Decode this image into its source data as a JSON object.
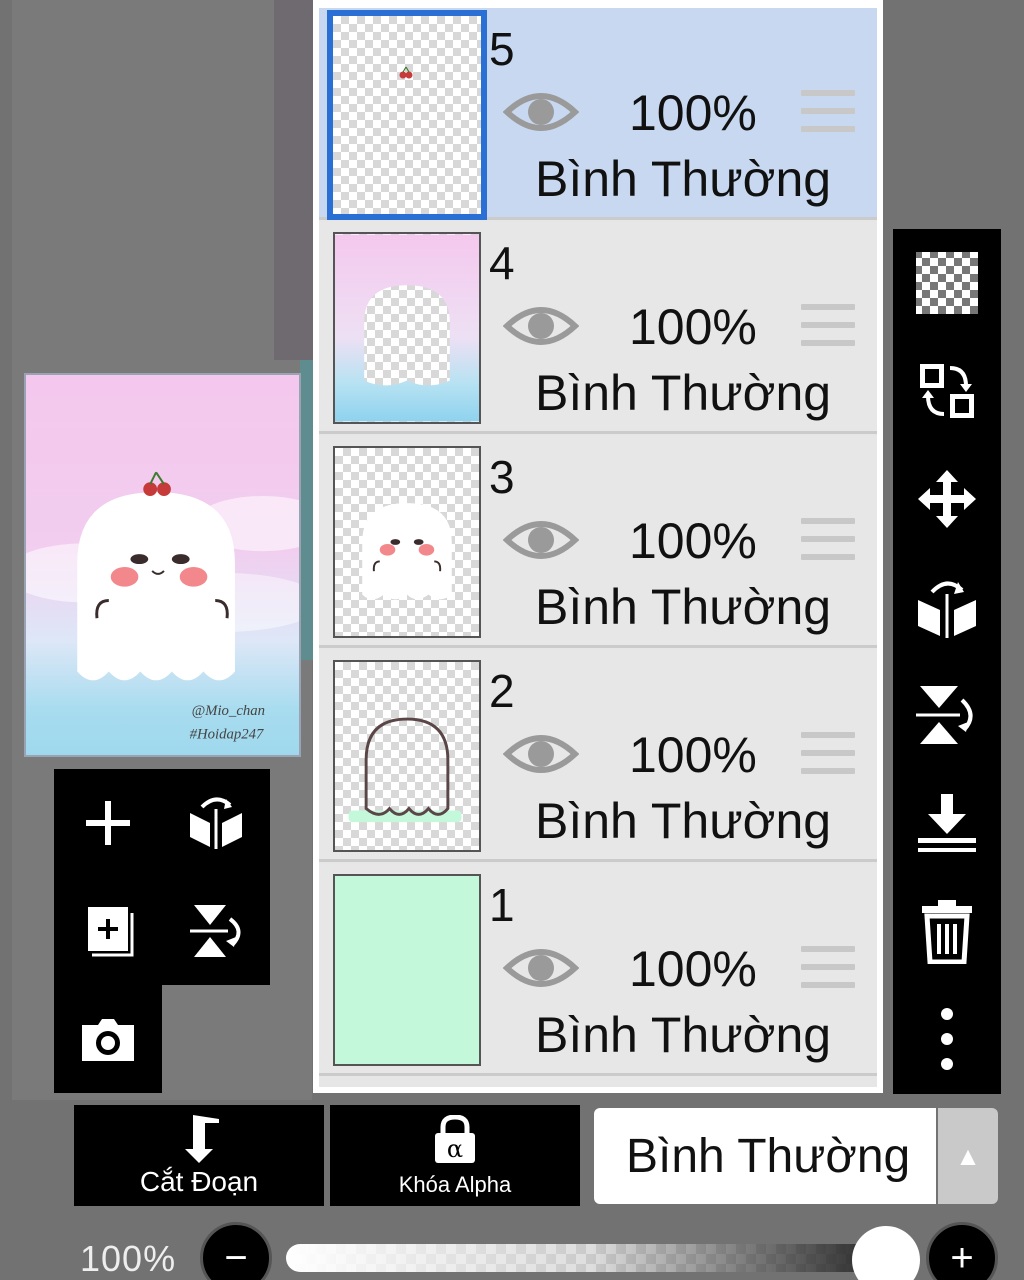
{
  "layers": [
    {
      "number": "5",
      "opacity": "100%",
      "blend": "Bình Thường",
      "selected": true
    },
    {
      "number": "4",
      "opacity": "100%",
      "blend": "Bình Thường",
      "selected": false
    },
    {
      "number": "3",
      "opacity": "100%",
      "blend": "Bình Thường",
      "selected": false
    },
    {
      "number": "2",
      "opacity": "100%",
      "blend": "Bình Thường",
      "selected": false
    },
    {
      "number": "1",
      "opacity": "100%",
      "blend": "Bình Thường",
      "selected": false
    }
  ],
  "preview": {
    "watermark_line1": "@Mio_chan",
    "watermark_line2": "#Hoidap247"
  },
  "left_tools": [
    "add-layer",
    "flip-horizontal",
    "duplicate-layer",
    "flip-vertical",
    "camera"
  ],
  "right_tools": [
    "transparency",
    "swap-layers",
    "move",
    "flip-horizontal",
    "flip-vertical",
    "merge-down",
    "delete",
    "more"
  ],
  "bottom_bar": {
    "clip_label": "Cắt Đoạn",
    "alpha_lock_label": "Khóa Alpha",
    "blend_mode_value": "Bình Thường",
    "blend_arrow": "▲"
  },
  "opacity_slider": {
    "label": "100%",
    "value": 1.0,
    "minus": "−",
    "plus": "+"
  },
  "colors": {
    "selected_row": "#c8d8f0",
    "selected_border": "#2a6fd3",
    "layer1_fill": "#c4f8da"
  }
}
